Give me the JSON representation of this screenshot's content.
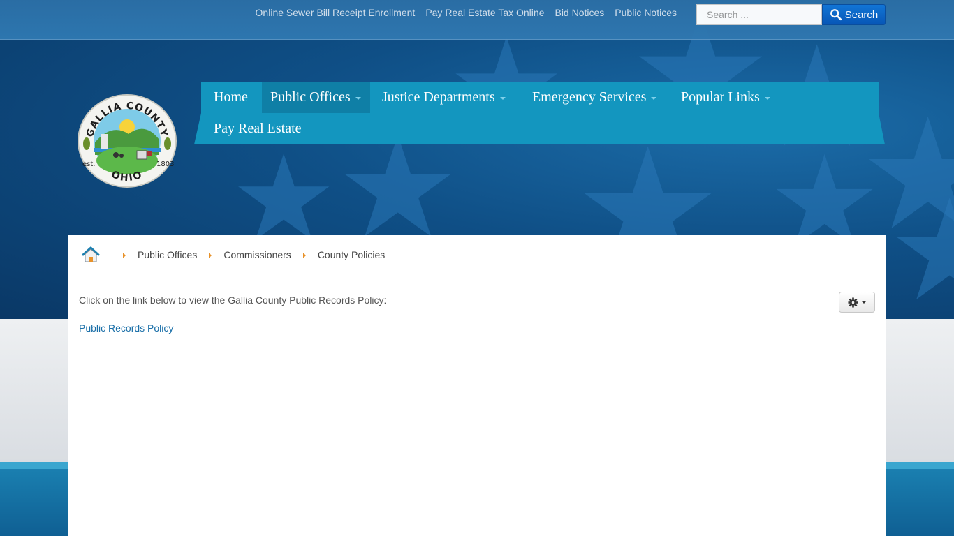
{
  "topbar": {
    "links": [
      "Online Sewer Bill Receipt Enrollment",
      "Pay Real Estate Tax Online",
      "Bid Notices",
      "Public Notices"
    ],
    "search_placeholder": "Search ...",
    "search_button": "Search"
  },
  "logo": {
    "top_text": "GALLIA COUNTY",
    "bottom_text": "OHIO",
    "est_left": "est.",
    "est_right": "1803"
  },
  "nav": {
    "row1": [
      {
        "label": "Home",
        "dropdown": false,
        "active": false
      },
      {
        "label": "Public Offices",
        "dropdown": true,
        "active": true
      },
      {
        "label": "Justice Departments",
        "dropdown": true,
        "active": false
      },
      {
        "label": "Emergency Services",
        "dropdown": true,
        "active": false
      },
      {
        "label": "Popular Links",
        "dropdown": true,
        "active": false
      }
    ],
    "row2": [
      {
        "label": "Pay Real Estate",
        "dropdown": false,
        "active": false
      }
    ]
  },
  "breadcrumb": {
    "items": [
      "Public Offices",
      "Commissioners"
    ],
    "current": "County Policies"
  },
  "content": {
    "intro": "Click on the link below to view the Gallia County Public Records Policy:",
    "link": "Public Records Policy"
  },
  "colors": {
    "nav_bg": "#1396bf",
    "nav_active": "#0f7fa6",
    "link": "#1a6fa8",
    "breadcrumb_arrow": "#e8922a",
    "search_button": "#0757b8"
  },
  "icons": {
    "search_button": "search-icon",
    "breadcrumb_home": "home-icon",
    "options": "gear-icon"
  }
}
